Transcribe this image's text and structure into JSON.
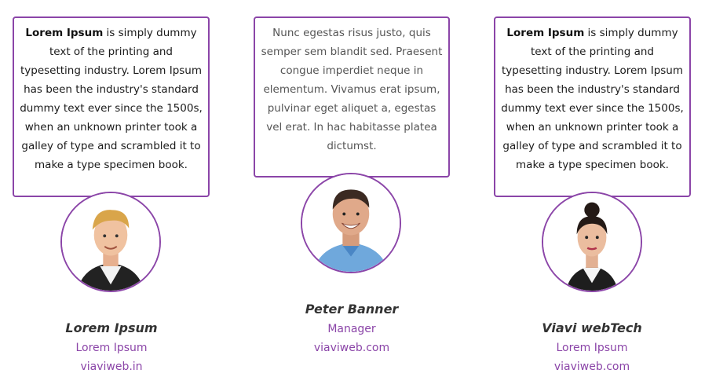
{
  "testimonials": [
    {
      "quote_bold": "Lorem Ipsum",
      "quote_rest": " is simply dummy text of the printing and typesetting industry. Lorem Ipsum has been the industry's standard dummy text ever since the 1500s, when an unknown printer took a galley of type and scrambled it to make a type specimen book.",
      "name": "Lorem Ipsum",
      "role": "Lorem Ipsum",
      "site": "viaviweb.in",
      "avatar_icon": "young-man-photo"
    },
    {
      "quote_bold": "",
      "quote_rest": "Nunc egestas risus justo, quis semper sem blandit sed. Praesent congue imperdiet neque in elementum. Vivamus erat ipsum, pulvinar eget aliquet a, egestas vel erat. In hac habitasse platea dictumst.",
      "name": "Peter Banner",
      "role": "Manager",
      "site": "viaviweb.com",
      "avatar_icon": "smiling-man-photo"
    },
    {
      "quote_bold": "Lorem Ipsum",
      "quote_rest": " is simply dummy text of the printing and typesetting industry. Lorem Ipsum has been the industry's standard dummy text ever since the 1500s, when an unknown printer took a galley of type and scrambled it to make a type specimen book.",
      "name": "Viavi webTech",
      "role": "Lorem Ipsum",
      "site": "viaviweb.com",
      "avatar_icon": "woman-photo"
    }
  ],
  "colors": {
    "accent": "#8b45a8",
    "name_text": "#333333"
  }
}
